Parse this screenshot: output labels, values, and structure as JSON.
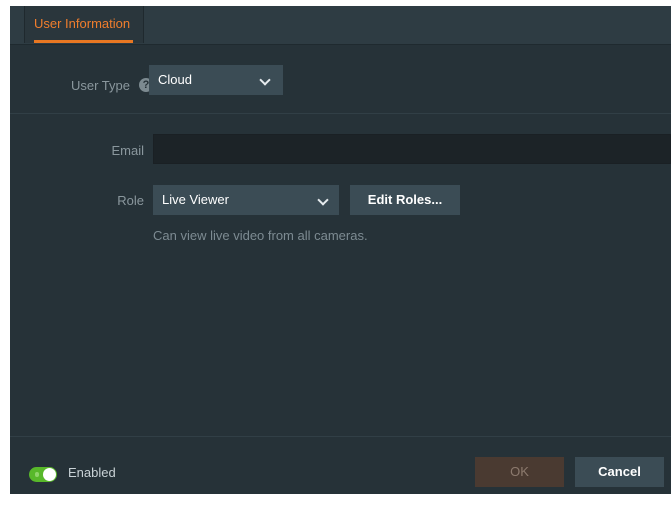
{
  "tabs": [
    {
      "label": "User Information",
      "active": true
    }
  ],
  "user_type": {
    "label": "User Type",
    "help_icon": "question-circle-icon",
    "selected": "Cloud"
  },
  "email": {
    "label": "Email",
    "value": "",
    "placeholder": ""
  },
  "role": {
    "label": "Role",
    "selected": "Live Viewer",
    "edit_button": "Edit Roles...",
    "description": "Can view live video from all cameras."
  },
  "footer": {
    "enabled_label": "Enabled",
    "enabled": true,
    "ok_label": "OK",
    "cancel_label": "Cancel"
  },
  "colors": {
    "background": "#263238",
    "accent": "#e87722",
    "toggle_on": "#58b82a",
    "ok_disabled": "#4a3a31",
    "button": "#3b4c55"
  }
}
